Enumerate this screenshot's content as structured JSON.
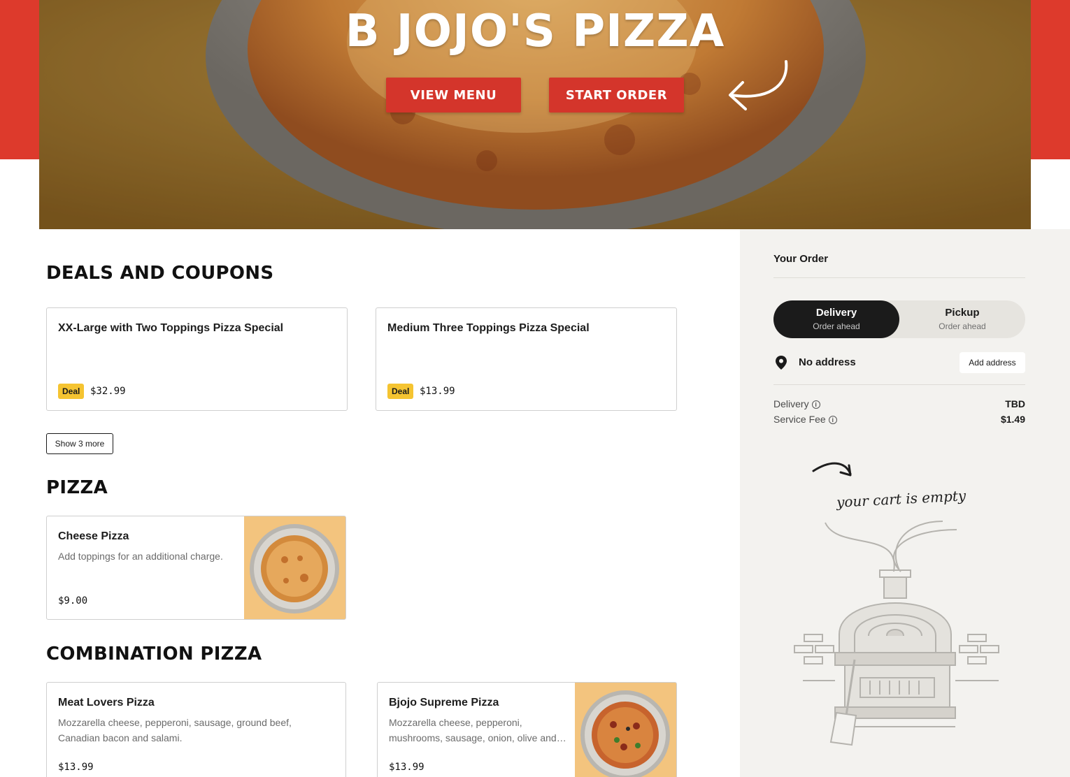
{
  "hero": {
    "title": "B JOJO'S PIZZA",
    "view_menu_label": "VIEW MENU",
    "start_order_label": "START ORDER"
  },
  "deals": {
    "heading": "DEALS AND COUPONS",
    "items": [
      {
        "title": "XX-Large with Two Toppings Pizza Special",
        "badge": "Deal",
        "price": "$32.99"
      },
      {
        "title": "Medium Three Toppings Pizza Special",
        "badge": "Deal",
        "price": "$13.99"
      }
    ],
    "show_more_label": "Show 3 more"
  },
  "pizza": {
    "heading": "PIZZA",
    "items": [
      {
        "title": "Cheese Pizza",
        "description": "Add toppings for an additional charge.",
        "price": "$9.00"
      }
    ]
  },
  "combination": {
    "heading": "COMBINATION PIZZA",
    "items": [
      {
        "title": "Meat Lovers Pizza",
        "description_line1": "Mozzarella cheese, pepperoni, sausage, ground beef,",
        "description_line2": "Canadian bacon and salami.",
        "price": "$13.99"
      },
      {
        "title": "Bjojo Supreme Pizza",
        "description_line1": "Mozzarella cheese, pepperoni,",
        "description_line2": "mushrooms, sausage, onion, olive and…",
        "price": "$13.99"
      }
    ]
  },
  "order": {
    "title": "Your Order",
    "delivery_label": "Delivery",
    "delivery_sub": "Order ahead",
    "pickup_label": "Pickup",
    "pickup_sub": "Order ahead",
    "address_text": "No address",
    "add_address_label": "Add address",
    "fees": [
      {
        "label": "Delivery",
        "value": "TBD"
      },
      {
        "label": "Service Fee",
        "value": "$1.49"
      }
    ],
    "empty_cart_text": "your cart is empty"
  },
  "colors": {
    "brand_red": "#dd3a2c",
    "deal_yellow": "#f5c431",
    "sidebar_bg": "#f3f2ef"
  }
}
